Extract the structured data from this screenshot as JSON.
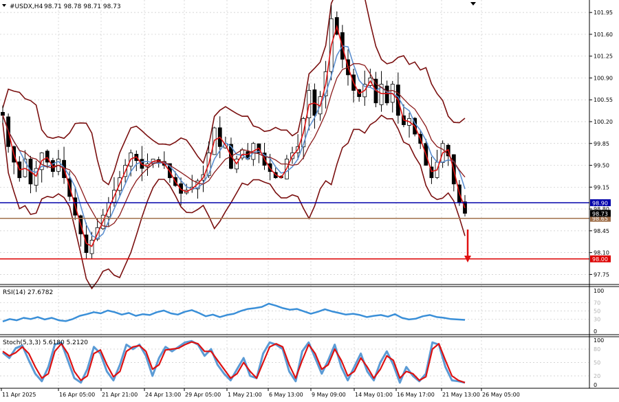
{
  "header": {
    "symbol": "#USDX,H4",
    "ohlc": "98.71 98.78 98.71 98.73"
  },
  "chart_data": [
    {
      "type": "candlestick",
      "title": "#USDX,H4",
      "ylim": [
        97.6,
        102.15
      ],
      "price_ticks": [
        "101.95",
        "101.60",
        "101.25",
        "100.90",
        "100.55",
        "100.20",
        "99.85",
        "99.50",
        "99.15",
        "98.80",
        "98.45",
        "98.10",
        "97.75"
      ],
      "time_labels": [
        "11 Apr 2025",
        "16 Apr 05:00",
        "21 Apr 21:00",
        "24 Apr 13:00",
        "29 Apr 05:00",
        "1 May 21:00",
        "6 May 13:00",
        "9 May 09:00",
        "14 May 01:00",
        "16 May 17:00",
        "21 May 13:00",
        "26 May 05:00"
      ],
      "levels": [
        {
          "label": "98.90",
          "value": 98.9,
          "color": "#0000aa"
        },
        {
          "label": "98.65",
          "value": 98.65,
          "color": "#a0704b"
        },
        {
          "label": "98.00",
          "value": 98.0,
          "color": "#dd0000"
        }
      ],
      "current_price": "98.73",
      "close_path": [
        [
          0,
          100.3
        ],
        [
          1,
          99.8
        ],
        [
          3,
          99.3
        ],
        [
          4,
          99.6
        ],
        [
          5,
          99.2
        ],
        [
          7,
          99.7
        ],
        [
          9,
          99.4
        ],
        [
          10,
          99.6
        ],
        [
          11,
          99.3
        ],
        [
          13,
          98.7
        ],
        [
          14,
          98.4
        ],
        [
          15,
          98.1
        ],
        [
          16,
          98.3
        ],
        [
          17,
          98.5
        ],
        [
          18,
          98.7
        ],
        [
          19,
          98.9
        ],
        [
          21,
          99.3
        ],
        [
          23,
          99.7
        ],
        [
          25,
          99.45
        ],
        [
          27,
          99.6
        ],
        [
          29,
          99.5
        ],
        [
          30,
          99.3
        ],
        [
          32,
          99.05
        ],
        [
          34,
          99.15
        ],
        [
          36,
          99.35
        ],
        [
          37,
          99.7
        ],
        [
          38,
          100.1
        ],
        [
          39,
          99.8
        ],
        [
          40,
          99.85
        ],
        [
          41,
          99.45
        ],
        [
          43,
          99.75
        ],
        [
          44,
          99.6
        ],
        [
          45,
          99.85
        ],
        [
          46,
          99.7
        ],
        [
          47,
          99.5
        ],
        [
          49,
          99.3
        ],
        [
          50,
          99.3
        ],
        [
          51,
          99.6
        ],
        [
          53,
          99.8
        ],
        [
          55,
          100.7
        ],
        [
          56,
          100.3
        ],
        [
          57,
          100.6
        ],
        [
          58,
          101.0
        ],
        [
          59,
          101.85
        ],
        [
          60,
          101.6
        ],
        [
          61,
          101.2
        ],
        [
          62,
          100.95
        ],
        [
          63,
          100.7
        ],
        [
          64,
          100.6
        ],
        [
          65,
          100.8
        ],
        [
          66,
          100.9
        ],
        [
          67,
          100.5
        ],
        [
          68,
          100.8
        ],
        [
          69,
          100.5
        ],
        [
          70,
          100.8
        ],
        [
          71,
          100.3
        ],
        [
          72,
          100.15
        ],
        [
          73,
          100.25
        ],
        [
          74,
          100.0
        ],
        [
          75,
          99.85
        ],
        [
          76,
          99.5
        ],
        [
          77,
          99.3
        ],
        [
          78,
          99.55
        ],
        [
          79,
          99.85
        ],
        [
          80,
          99.65
        ],
        [
          81,
          99.2
        ],
        [
          82,
          98.9
        ],
        [
          83,
          98.73
        ]
      ]
    },
    {
      "type": "line",
      "title": "RSI(14) 27.6782",
      "ylim": [
        0,
        100
      ],
      "ticks": [
        "100",
        "70",
        "50",
        "30",
        "0"
      ],
      "series": [
        {
          "color": "#3a8fd8",
          "values": [
            24,
            30,
            27,
            33,
            30,
            35,
            29,
            33,
            27,
            25,
            30,
            38,
            42,
            47,
            44,
            51,
            47,
            41,
            45,
            38,
            42,
            40,
            47,
            51,
            44,
            41,
            48,
            52,
            45,
            37,
            41,
            35,
            40,
            43,
            50,
            55,
            57,
            60,
            68,
            63,
            57,
            53,
            55,
            49,
            43,
            48,
            54,
            49,
            45,
            41,
            43,
            40,
            35,
            38,
            40,
            36,
            42,
            33,
            29,
            31,
            37,
            40,
            35,
            33,
            30,
            29,
            28
          ]
        }
      ]
    },
    {
      "type": "line",
      "title": "Stoch(5,3,3) 5.6180 5.2120",
      "ylim": [
        0,
        100
      ],
      "ticks": [
        "100",
        "80",
        "50",
        "20",
        "0"
      ],
      "series": [
        {
          "color": "#5b9bd5",
          "values": [
            72,
            60,
            82,
            88,
            55,
            25,
            8,
            40,
            90,
            95,
            55,
            15,
            5,
            35,
            85,
            70,
            30,
            10,
            45,
            90,
            80,
            90,
            65,
            20,
            60,
            85,
            75,
            85,
            95,
            98,
            90,
            65,
            80,
            45,
            25,
            10,
            35,
            60,
            20,
            15,
            70,
            95,
            90,
            80,
            30,
            8,
            75,
            95,
            60,
            25,
            55,
            90,
            40,
            10,
            40,
            70,
            30,
            10,
            50,
            75,
            45,
            5,
            40,
            20,
            8,
            25,
            95,
            90,
            40,
            10,
            8,
            5
          ]
        },
        {
          "color": "#dd1111",
          "values": [
            75,
            65,
            72,
            85,
            70,
            40,
            15,
            25,
            75,
            92,
            70,
            30,
            10,
            20,
            70,
            78,
            45,
            18,
            30,
            75,
            85,
            88,
            75,
            35,
            45,
            78,
            80,
            82,
            90,
            96,
            92,
            75,
            75,
            55,
            35,
            15,
            25,
            50,
            30,
            15,
            50,
            85,
            92,
            85,
            45,
            15,
            55,
            90,
            70,
            35,
            45,
            80,
            55,
            20,
            30,
            60,
            40,
            15,
            35,
            65,
            55,
            15,
            30,
            25,
            10,
            18,
            80,
            92,
            55,
            20,
            10,
            5
          ]
        }
      ]
    }
  ]
}
